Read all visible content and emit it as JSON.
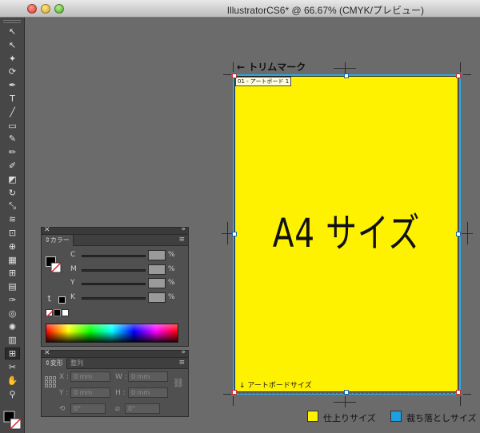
{
  "window": {
    "title": "IllustratorCS6* @ 66.67% (CMYK/プレビュー)"
  },
  "tools": [
    {
      "name": "selection-tool",
      "glyph": "↖"
    },
    {
      "name": "direct-selection-tool",
      "glyph": "↖"
    },
    {
      "name": "magic-wand-tool",
      "glyph": "✦"
    },
    {
      "name": "lasso-tool",
      "glyph": "⟳"
    },
    {
      "name": "pen-tool",
      "glyph": "✒"
    },
    {
      "name": "type-tool",
      "glyph": "T"
    },
    {
      "name": "line-tool",
      "glyph": "╱"
    },
    {
      "name": "rectangle-tool",
      "glyph": "▭"
    },
    {
      "name": "paintbrush-tool",
      "glyph": "✎"
    },
    {
      "name": "pencil-tool",
      "glyph": "✏"
    },
    {
      "name": "blob-brush-tool",
      "glyph": "✐"
    },
    {
      "name": "eraser-tool",
      "glyph": "◩"
    },
    {
      "name": "rotate-tool",
      "glyph": "↻"
    },
    {
      "name": "scale-tool",
      "glyph": "⤡"
    },
    {
      "name": "width-tool",
      "glyph": "≋"
    },
    {
      "name": "free-transform-tool",
      "glyph": "⊡"
    },
    {
      "name": "shape-builder-tool",
      "glyph": "⊕"
    },
    {
      "name": "perspective-grid-tool",
      "glyph": "▦"
    },
    {
      "name": "mesh-tool",
      "glyph": "⊞"
    },
    {
      "name": "gradient-tool",
      "glyph": "▤"
    },
    {
      "name": "eyedropper-tool",
      "glyph": "✑"
    },
    {
      "name": "blend-tool",
      "glyph": "◎"
    },
    {
      "name": "symbol-sprayer-tool",
      "glyph": "✺"
    },
    {
      "name": "column-graph-tool",
      "glyph": "▥"
    },
    {
      "name": "artboard-tool",
      "glyph": "⊞"
    },
    {
      "name": "slice-tool",
      "glyph": "✂"
    },
    {
      "name": "hand-tool",
      "glyph": "✋"
    },
    {
      "name": "zoom-tool",
      "glyph": "⚲"
    }
  ],
  "canvas": {
    "trim_mark_label": "← トリムマーク",
    "artboard_label": "01 - アートボード 1",
    "main_text": "A4 サイズ",
    "artboard_size_label": "↓ アートボードサイズ",
    "colors": {
      "finish": "#fff200",
      "bleed": "#2ba6e0"
    },
    "legend": [
      {
        "label": "仕上りサイズ",
        "color": "#fff200"
      },
      {
        "label": "裁ち落としサイズ",
        "color": "#1ba1e2"
      }
    ]
  },
  "color_panel": {
    "tab": "カラー",
    "channels": [
      {
        "label": "C",
        "unit": "%"
      },
      {
        "label": "M",
        "unit": "%"
      },
      {
        "label": "Y",
        "unit": "%"
      },
      {
        "label": "K",
        "unit": "%"
      }
    ]
  },
  "transform_panel": {
    "tabs": [
      "変形",
      "整列"
    ],
    "x_label": "X :",
    "x_value": "0 mm",
    "y_label": "Y :",
    "y_value": "0 mm",
    "w_label": "W :",
    "w_value": "0 mm",
    "h_label": "H :",
    "h_value": "0 mm",
    "rotate_value": "0°",
    "shear_value": "0°"
  }
}
